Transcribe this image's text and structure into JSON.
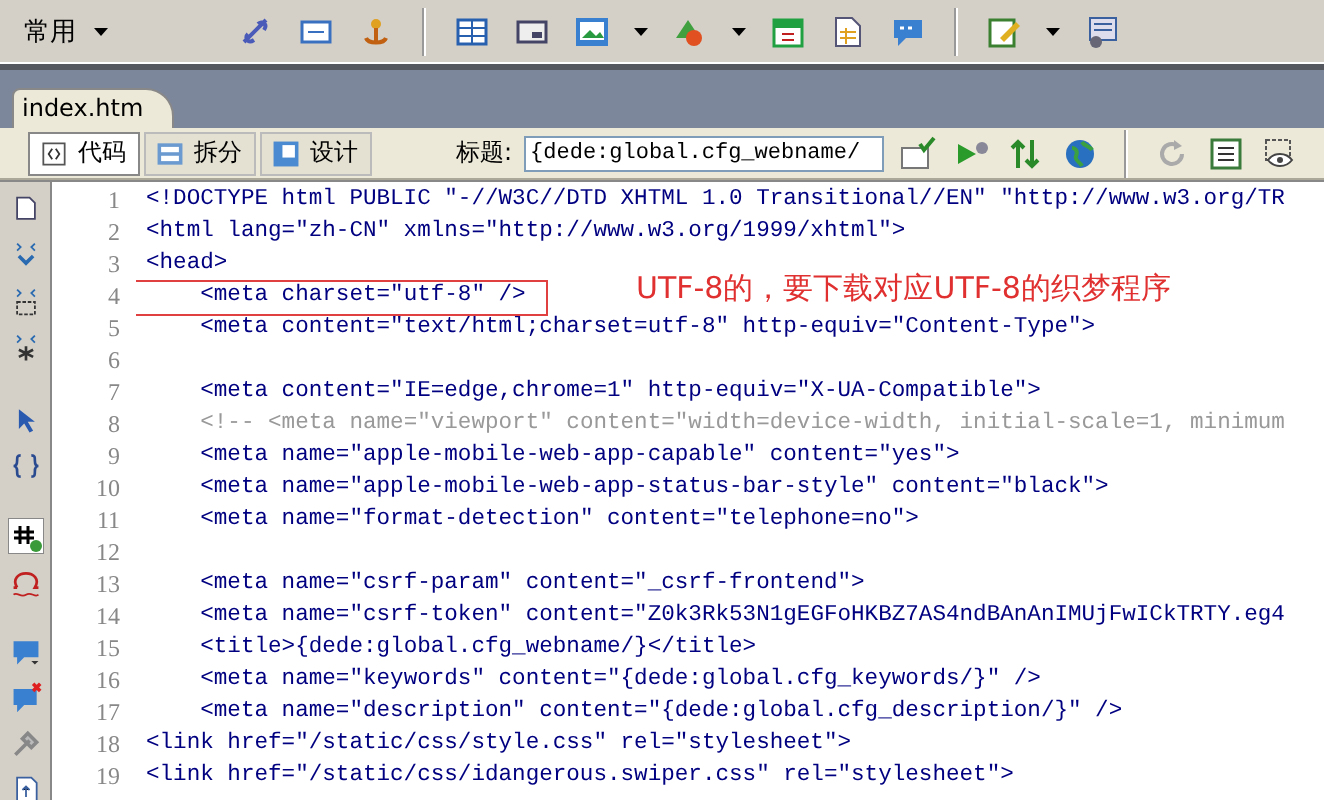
{
  "insert_bar": {
    "category": "常用"
  },
  "document_tab": {
    "label": "index.htm",
    "selected": true
  },
  "view_buttons": [
    {
      "label": "代码",
      "selected": true
    },
    {
      "label": "拆分",
      "selected": false
    },
    {
      "label": "设计",
      "selected": false
    }
  ],
  "title_field": {
    "label": "标题:",
    "value": "{dede:global.cfg_webname/"
  },
  "code_lines": [
    {
      "number": "1",
      "text": "<!DOCTYPE html PUBLIC \"-//W3C//DTD XHTML 1.0 Transitional//EN\" \"http://www.w3.org/TR",
      "kind": "code",
      "highlighted": false
    },
    {
      "number": "2",
      "text": "<html lang=\"zh-CN\" xmlns=\"http://www.w3.org/1999/xhtml\">",
      "kind": "code",
      "highlighted": false
    },
    {
      "number": "3",
      "text": "<head>",
      "kind": "code",
      "highlighted": false
    },
    {
      "number": "4",
      "text": "    <meta charset=\"utf-8\" />",
      "kind": "code",
      "highlighted": true
    },
    {
      "number": "5",
      "text": "    <meta content=\"text/html;charset=utf-8\" http-equiv=\"Content-Type\">",
      "kind": "code",
      "highlighted": false
    },
    {
      "number": "6",
      "kind": "code",
      "highlighted": false
    },
    {
      "number": "7",
      "text": "    <meta content=\"IE=edge,chrome=1\" http-equiv=\"X-UA-Compatible\">",
      "kind": "code",
      "highlighted": false
    },
    {
      "number": "8",
      "text": "    <!-- <meta name=\"viewport\" content=\"width=device-width, initial-scale=1, minimum",
      "kind": "comment",
      "highlighted": false
    },
    {
      "number": "9",
      "text": "    <meta name=\"apple-mobile-web-app-capable\" content=\"yes\">",
      "kind": "code",
      "highlighted": false
    },
    {
      "number": "10",
      "text": "    <meta name=\"apple-mobile-web-app-status-bar-style\" content=\"black\">",
      "kind": "code",
      "highlighted": false
    },
    {
      "number": "11",
      "text": "    <meta name=\"format-detection\" content=\"telephone=no\">",
      "kind": "code",
      "highlighted": false
    },
    {
      "number": "12",
      "kind": "code",
      "highlighted": false
    },
    {
      "number": "13",
      "text": "    <meta name=\"csrf-param\" content=\"_csrf-frontend\">",
      "kind": "code",
      "highlighted": false
    },
    {
      "number": "14",
      "text": "    <meta name=\"csrf-token\" content=\"Z0k3Rk53N1gEGFoHKBZ7AS4ndBAnAnIMUjFwICkTRTY.eg4",
      "kind": "code",
      "highlighted": false
    },
    {
      "number": "15",
      "text": "    <title>{dede:global.cfg_webname/}</title>",
      "kind": "code",
      "highlighted": false
    },
    {
      "number": "16",
      "text": "    <meta name=\"keywords\" content=\"{dede:global.cfg_keywords/}\" />",
      "kind": "code",
      "highlighted": false
    },
    {
      "number": "17",
      "text": "    <meta name=\"description\" content=\"{dede:global.cfg_description/}\" />",
      "kind": "code",
      "highlighted": false
    },
    {
      "number": "18",
      "text": "<link href=\"/static/css/style.css\" rel=\"stylesheet\">",
      "kind": "code",
      "highlighted": false
    },
    {
      "number": "19",
      "text": "<link href=\"/static/css/idangerous.swiper.css\" rel=\"stylesheet\">",
      "kind": "code",
      "highlighted": false
    }
  ],
  "annotation": {
    "text": "UTF-8的，要下载对应UTF-8的织梦程序"
  }
}
